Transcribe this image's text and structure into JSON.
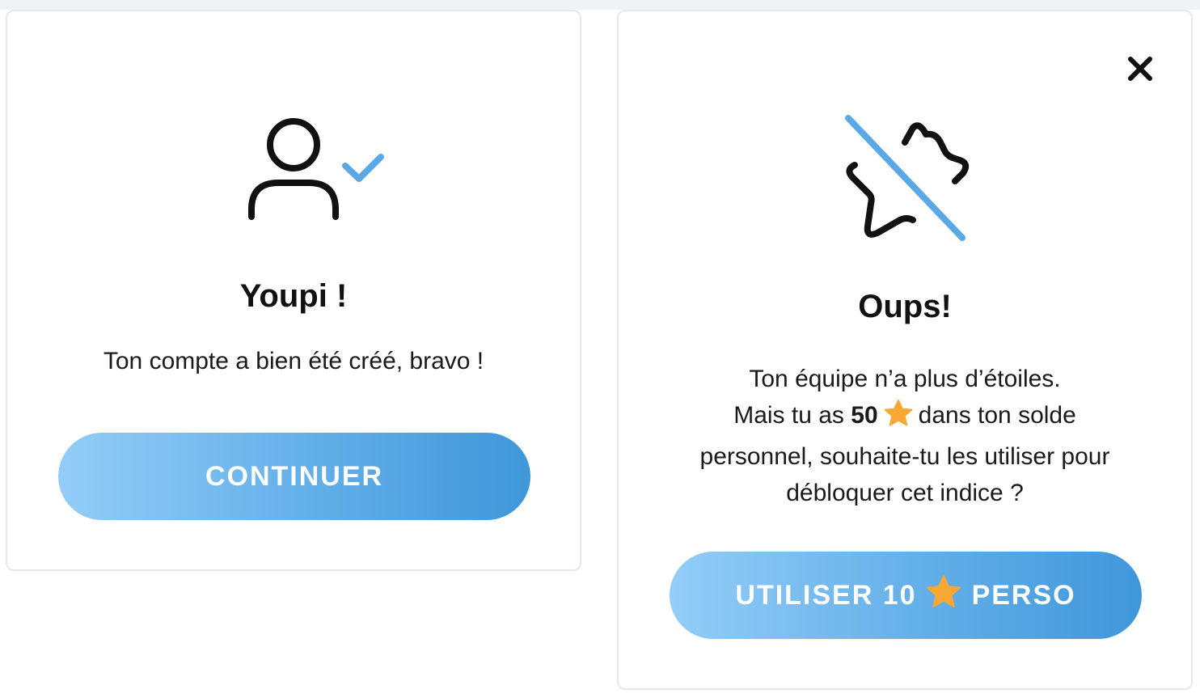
{
  "left_card": {
    "title": "Youpi !",
    "message": "Ton compte a bien été créé, bravo !",
    "continue_label": "CONTINUER",
    "icon": "user-check-icon"
  },
  "right_card": {
    "title": "Oups!",
    "message_line1": "Ton équipe n’a plus d’étoiles.",
    "message_line2_prefix": "Mais tu as",
    "balance": "50",
    "message_line2_suffix": "dans ton solde",
    "message_line3": "personnel, souhaite-tu les utiliser pour",
    "message_line4": "débloquer cet indice ?",
    "button_prefix": "UTILISER 10",
    "button_suffix": "PERSO",
    "icon": "no-star-icon",
    "close_icon": "close-icon"
  },
  "colors": {
    "accent_blue": "#5aa9e6",
    "star_orange": "#f7a834",
    "text_dark": "#111111"
  }
}
